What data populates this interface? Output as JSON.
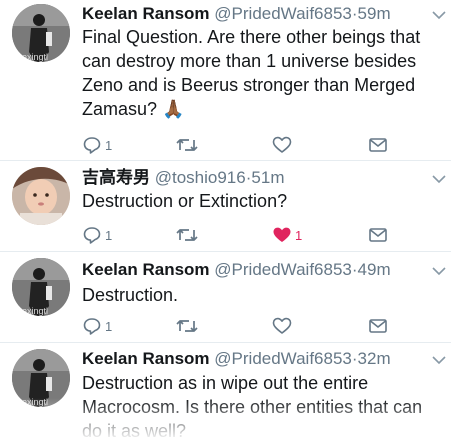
{
  "tweets": [
    {
      "name": "Keelan Ransom",
      "handle": "@PridedWaif6853",
      "time": "59m",
      "text": "Final Question. Are there other beings that can destroy more than 1 universe besides Zeno and is Beerus stronger than Merged Zamasu? 🙏🏾",
      "reply_count": "1",
      "retweet_count": "",
      "like_count": "",
      "liked": false,
      "avatar_icon": "bw-person-avatar-icon"
    },
    {
      "name": "吉高寿男",
      "handle": "@toshio916",
      "time": "51m",
      "text": "Destruction or Extinction?",
      "reply_count": "1",
      "retweet_count": "",
      "like_count": "1",
      "liked": true,
      "avatar_icon": "baby-photo-avatar-icon"
    },
    {
      "name": "Keelan Ransom",
      "handle": "@PridedWaif6853",
      "time": "49m",
      "text": "Destruction.",
      "reply_count": "1",
      "retweet_count": "",
      "like_count": "",
      "liked": false,
      "avatar_icon": "bw-person-avatar-icon"
    },
    {
      "name": "Keelan Ransom",
      "handle": "@PridedWaif6853",
      "time": "32m",
      "text": "Destruction as in wipe out the entire Macrocosm. Is there other entities that can do it as well?",
      "avatar_icon": "bw-person-avatar-icon"
    }
  ],
  "separator": "·",
  "colors": {
    "text": "#14171a",
    "secondary": "#657786",
    "like": "#e0245e",
    "divider": "#e6ecf0"
  }
}
